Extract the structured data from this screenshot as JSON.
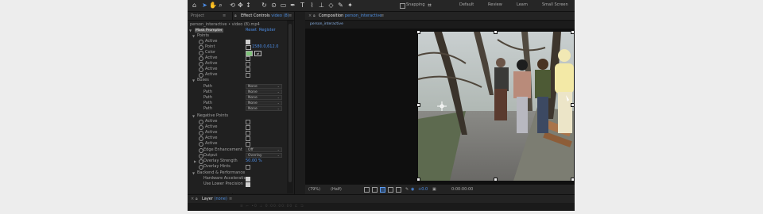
{
  "toolbar": {
    "snapping_label": "Snapping",
    "workspaces": [
      "Default",
      "Review",
      "Learn",
      "Small Screen"
    ]
  },
  "project_panel": {
    "tab_label": "Project"
  },
  "effect_controls": {
    "tab_label": "Effect Controls",
    "tab_sub": "video (8)",
    "layer_path": "person_interactive • video (8).mp4",
    "effect_name": "Mask Prompter",
    "reset_label": "Reset",
    "register_label": "Register",
    "points_group": "Points",
    "points_rows": [
      {
        "label": "Active",
        "checked": true
      },
      {
        "label": "Point",
        "value": "1580.0,612.0"
      },
      {
        "label": "Color"
      },
      {
        "label": "Active",
        "checked": false
      },
      {
        "label": "Active",
        "checked": false
      },
      {
        "label": "Active",
        "checked": false
      },
      {
        "label": "Active",
        "checked": false
      }
    ],
    "boxes_group": "Boxes",
    "boxes_rows": [
      {
        "label": "Path",
        "value": "None"
      },
      {
        "label": "Path",
        "value": "None"
      },
      {
        "label": "Path",
        "value": "None"
      },
      {
        "label": "Path",
        "value": "None"
      },
      {
        "label": "Path",
        "value": "None"
      }
    ],
    "negative_group": "Negative Points",
    "negative_rows": [
      {
        "label": "Active"
      },
      {
        "label": "Active"
      },
      {
        "label": "Active"
      },
      {
        "label": "Active"
      },
      {
        "label": "Active"
      }
    ],
    "edge_enhancement_label": "Edge Enhancement",
    "edge_enhancement_value": "Off",
    "output_label": "Output",
    "output_value": "Overlay",
    "overlay_strength_label": "Overlay Strength",
    "overlay_strength_value": "50.00 %",
    "overlay_hints_label": "Overlay Hints",
    "backend_group": "Backend & Performance",
    "hardware_accel_label": "Hardware Acceleration",
    "lower_precision_label": "Use Lower Precision"
  },
  "composition": {
    "tab_label": "Composition",
    "tab_sub": "person_interactive",
    "path_label": "person_interactive",
    "footer": {
      "zoom": "(79%)",
      "resolution": "(Half)",
      "exposure": "+0.0",
      "timecode": "0:00:00:00"
    }
  },
  "layer_panel": {
    "tab_label": "Layer",
    "tab_sub": "(none)",
    "footer_text": "≡  ⌐  •0  ⊥  0:00:00:00  ⊏  ⊐"
  },
  "colors": {
    "accent": "#4d8ee8",
    "point_color": "#7fc37a",
    "mask_overlay": "#f3e9a6"
  }
}
